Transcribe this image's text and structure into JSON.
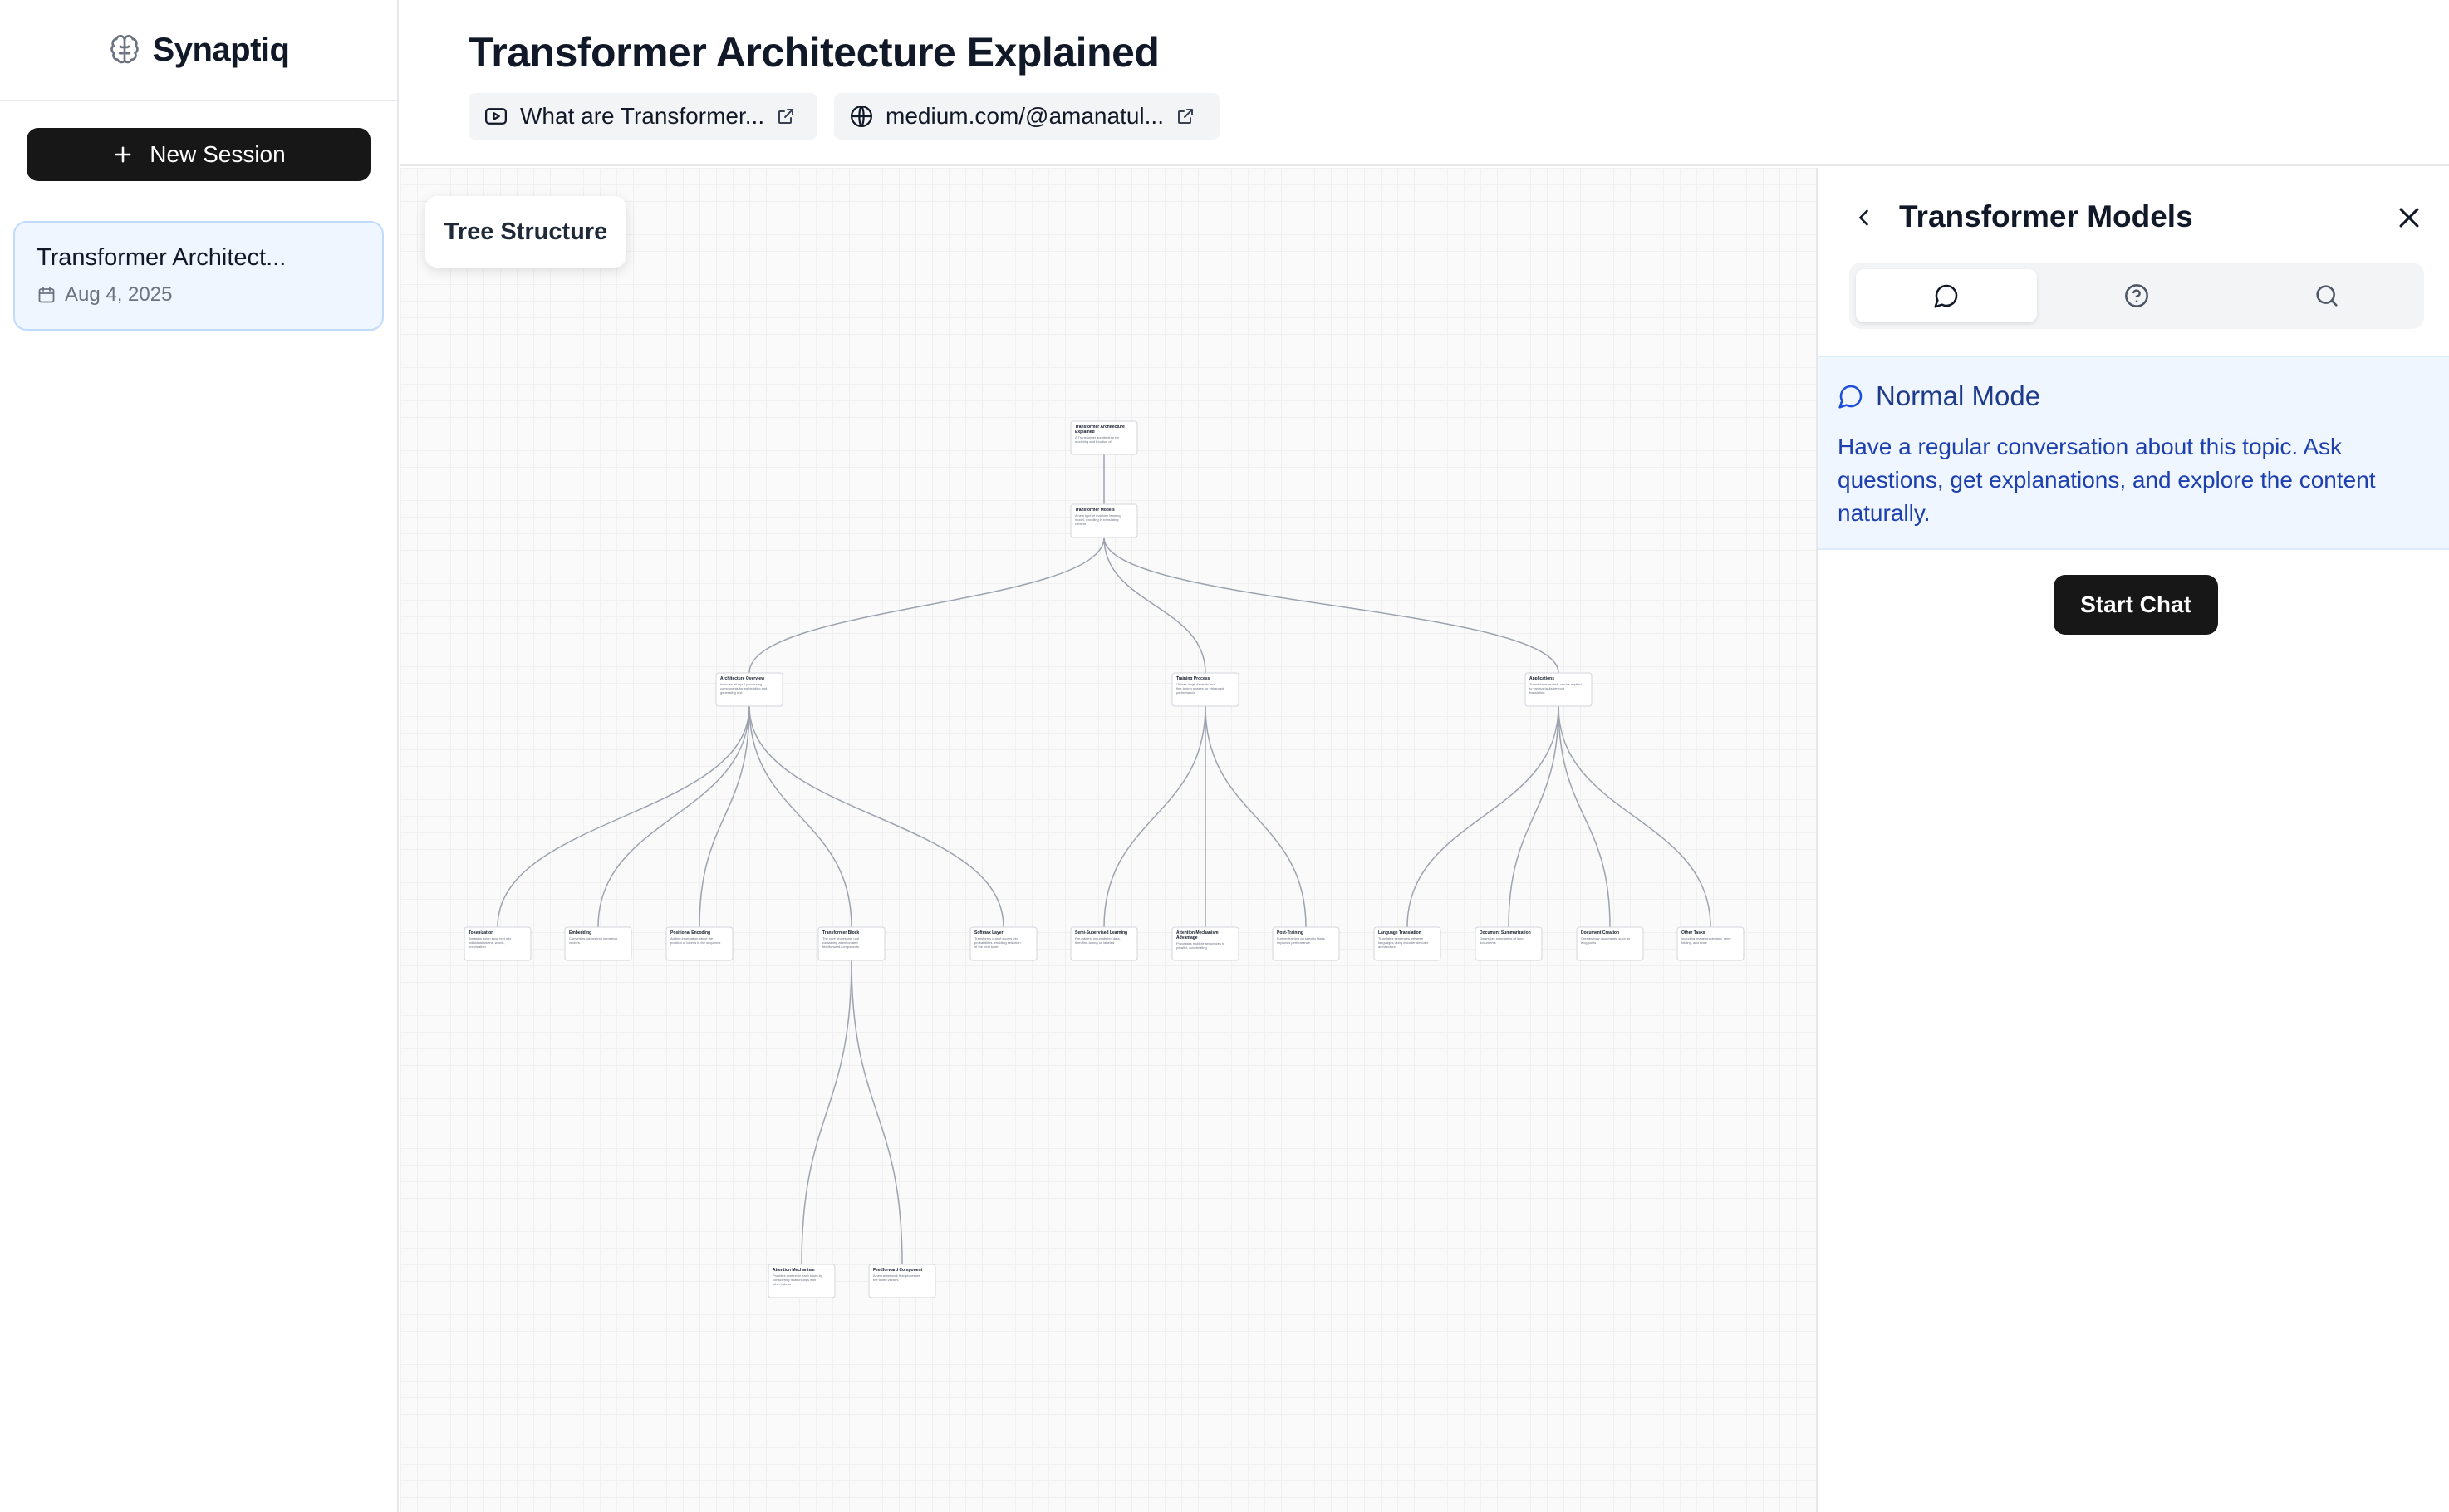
{
  "sidebar": {
    "brand_name": "Synaptiq",
    "new_session_label": "New Session",
    "sessions": [
      {
        "title": "Transformer Architect...",
        "date": "Aug 4, 2025"
      }
    ]
  },
  "header": {
    "title": "Transformer Architecture Explained",
    "sources": [
      {
        "type": "video",
        "label": "What are Transformer..."
      },
      {
        "type": "web",
        "label": "medium.com/@amanatul..."
      }
    ]
  },
  "canvas": {
    "view_label": "Tree Structure",
    "nodes": [
      {
        "title": "Transformer Architecture Explained",
        "desc": "A Transformer architecture for modeling and function of"
      },
      {
        "title": "Transformer Models",
        "desc": "A new type of machine learning model, excelling in translating content"
      },
      {
        "title": "Architecture Overview",
        "desc": "Includes all input processing components for embedding and generating text"
      },
      {
        "title": "Training Process",
        "desc": "Utilizes large datasets and fine-tuning phases for enhanced performance"
      },
      {
        "title": "Applications",
        "desc": "Transformer models can be applied to various tasks beyond translation"
      },
      {
        "title": "Tokenization",
        "desc": "Breaking down input text into individual tokens, words, punctuation"
      },
      {
        "title": "Embedding",
        "desc": "Converting tokens into numerical vectors"
      },
      {
        "title": "Positional Encoding",
        "desc": "Adding information about the position of tokens in the sequence"
      },
      {
        "title": "Transformer Block",
        "desc": "The core processing unit containing attention and feedforward components"
      },
      {
        "title": "Softmax Layer",
        "desc": "Transforms output scores into probabilities, enabling selection of the next token"
      },
      {
        "title": "Semi-Supervised Learning",
        "desc": "Pre-training on unlabeled data, then fine-tuning on labeled"
      },
      {
        "title": "Attention Mechanism Advantage",
        "desc": "Processes multiple sequences in parallel, accelerating"
      },
      {
        "title": "Post-Training",
        "desc": "Further training on specific tasks improves performance"
      },
      {
        "title": "Language Translation",
        "desc": "Translates sentences between languages using encoder-decoder architecture"
      },
      {
        "title": "Document Summarization",
        "desc": "Generates summaries of long documents"
      },
      {
        "title": "Document Creation",
        "desc": "Creates new documents, such as blog posts"
      },
      {
        "title": "Other Tasks",
        "desc": "Including image processing, gene folding, and more"
      },
      {
        "title": "Attention Mechanism",
        "desc": "Provides context to each token by considering relationships with other tokens"
      },
      {
        "title": "Feedforward Component",
        "desc": "A neural network that processes the token vectors"
      }
    ]
  },
  "panel": {
    "title": "Transformer Models",
    "tabs": [
      "chat-icon",
      "help-circle-icon",
      "search-icon"
    ],
    "mode_name": "Normal Mode",
    "mode_description": "Have a regular conversation about this topic. Ask questions, get explanations, and explore the content naturally.",
    "start_chat_label": "Start Chat"
  },
  "colors": {
    "primary_button": "#171717",
    "session_active_bg": "#eff6ff",
    "mode_info_text": "#1e40af"
  }
}
